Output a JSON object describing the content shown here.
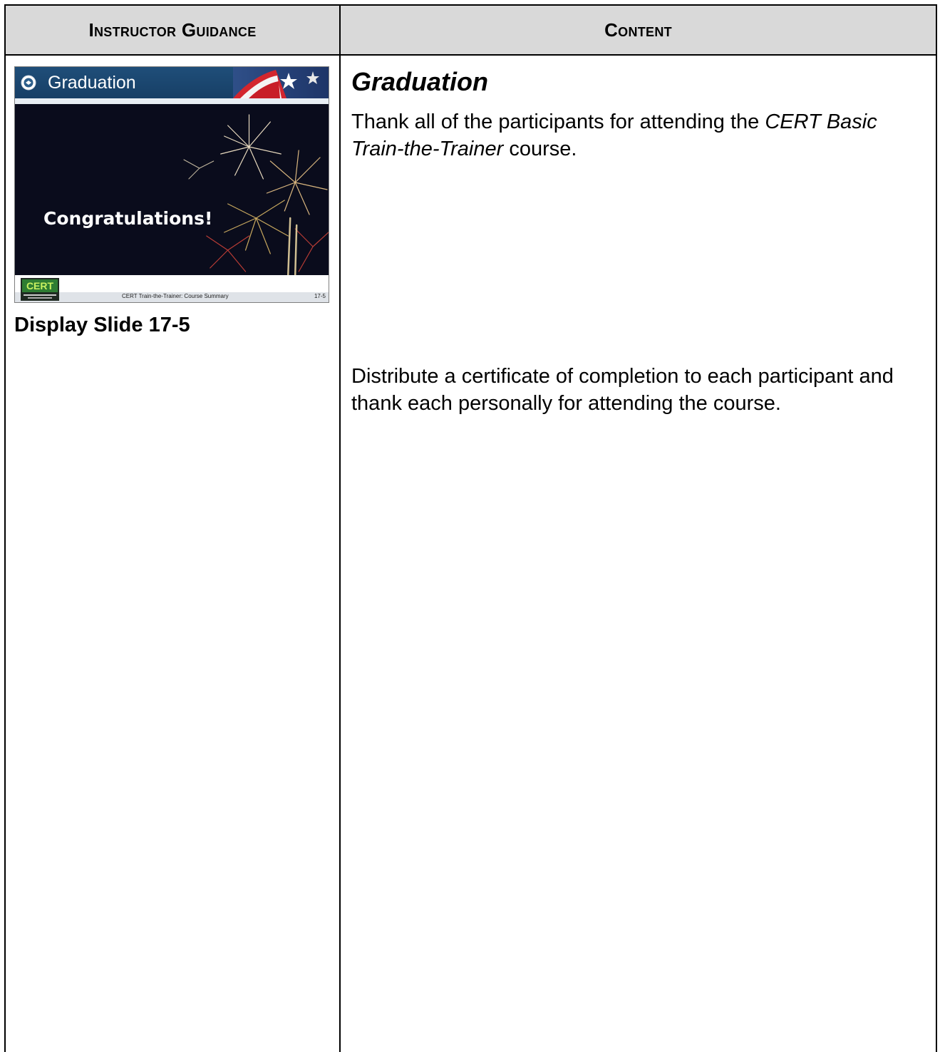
{
  "table": {
    "left_header": "Instructor Guidance",
    "right_header": "Content"
  },
  "slide": {
    "title": "Graduation",
    "congratulations": "Congratulations!",
    "footer_text": "CERT Train-the-Trainer:  Course Summary",
    "slide_number": "17-5",
    "logo_text": "CERT"
  },
  "guidance": {
    "display_label": "Display Slide 17-5"
  },
  "content": {
    "title": "Graduation",
    "para1_a": "Thank all of the participants for attending the ",
    "para1_italic": "CERT Basic Train-the-Trainer",
    "para1_b": " course.",
    "para2": "Distribute a certificate of completion to each participant and thank each personally for attending the course."
  }
}
